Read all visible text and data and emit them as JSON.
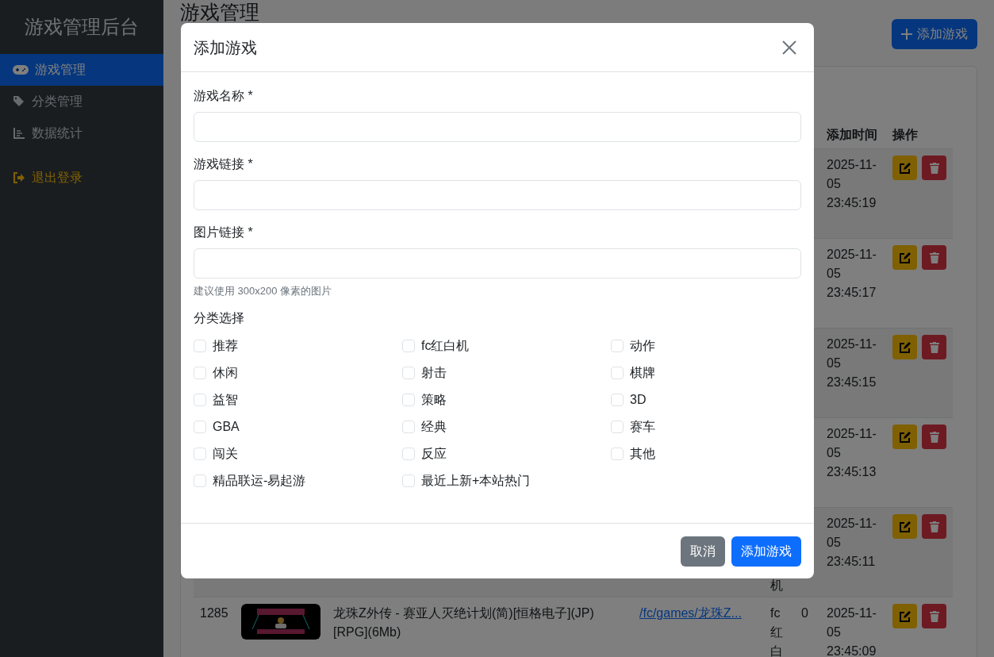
{
  "sidebar": {
    "title": "游戏管理后台",
    "items": [
      {
        "label": "游戏管理",
        "selected": true
      },
      {
        "label": "分类管理",
        "selected": false
      },
      {
        "label": "数据统计",
        "selected": false
      }
    ],
    "logout": "退出登录"
  },
  "page": {
    "title": "游戏管理",
    "add_button": "添加游戏"
  },
  "table": {
    "columns": [
      "添加时间",
      "操作"
    ],
    "rows": [
      {
        "time": "2025-11-05 23:45:19"
      },
      {
        "time": "2025-11-05 23:45:17"
      },
      {
        "time": "2025-11-05 23:45:15"
      },
      {
        "time": "2025-11-05 23:45:13"
      },
      {
        "category": "机",
        "time": "2025-11-05 23:45:11"
      },
      {
        "id": "1285",
        "name": "龙珠Z外传 - 赛亚人灭绝计划(简)[恒格电子](JP)[RPG](6Mb)",
        "link": "/fc/games/龙珠Z...",
        "category": "fc红白",
        "plays": "0",
        "time": "2025-11-05 23:45:09"
      }
    ]
  },
  "modal": {
    "title": "添加游戏",
    "fields": [
      {
        "label": "游戏名称 *"
      },
      {
        "label": "游戏链接 *"
      },
      {
        "label": "图片链接 *",
        "help": "建议使用 300x200 像素的图片"
      }
    ],
    "categories_label": "分类选择",
    "categories": [
      {
        "label": "推荐",
        "checked": false
      },
      {
        "label": "fc红白机",
        "checked": false
      },
      {
        "label": "动作",
        "checked": false
      },
      {
        "label": "休闲",
        "checked": false
      },
      {
        "label": "射击",
        "checked": false
      },
      {
        "label": "棋牌",
        "checked": false
      },
      {
        "label": "益智",
        "checked": false
      },
      {
        "label": "策略",
        "checked": false
      },
      {
        "label": "3D",
        "checked": false
      },
      {
        "label": "GBA",
        "checked": false
      },
      {
        "label": "经典",
        "checked": false
      },
      {
        "label": "赛车",
        "checked": false
      },
      {
        "label": "闯关",
        "checked": false
      },
      {
        "label": "反应",
        "checked": false
      },
      {
        "label": "其他",
        "checked": false
      },
      {
        "label": "精品联运-易起游",
        "checked": false
      },
      {
        "label": "最近上新+本站热门",
        "checked": false
      }
    ],
    "cancel": "取消",
    "submit": "添加游戏"
  }
}
